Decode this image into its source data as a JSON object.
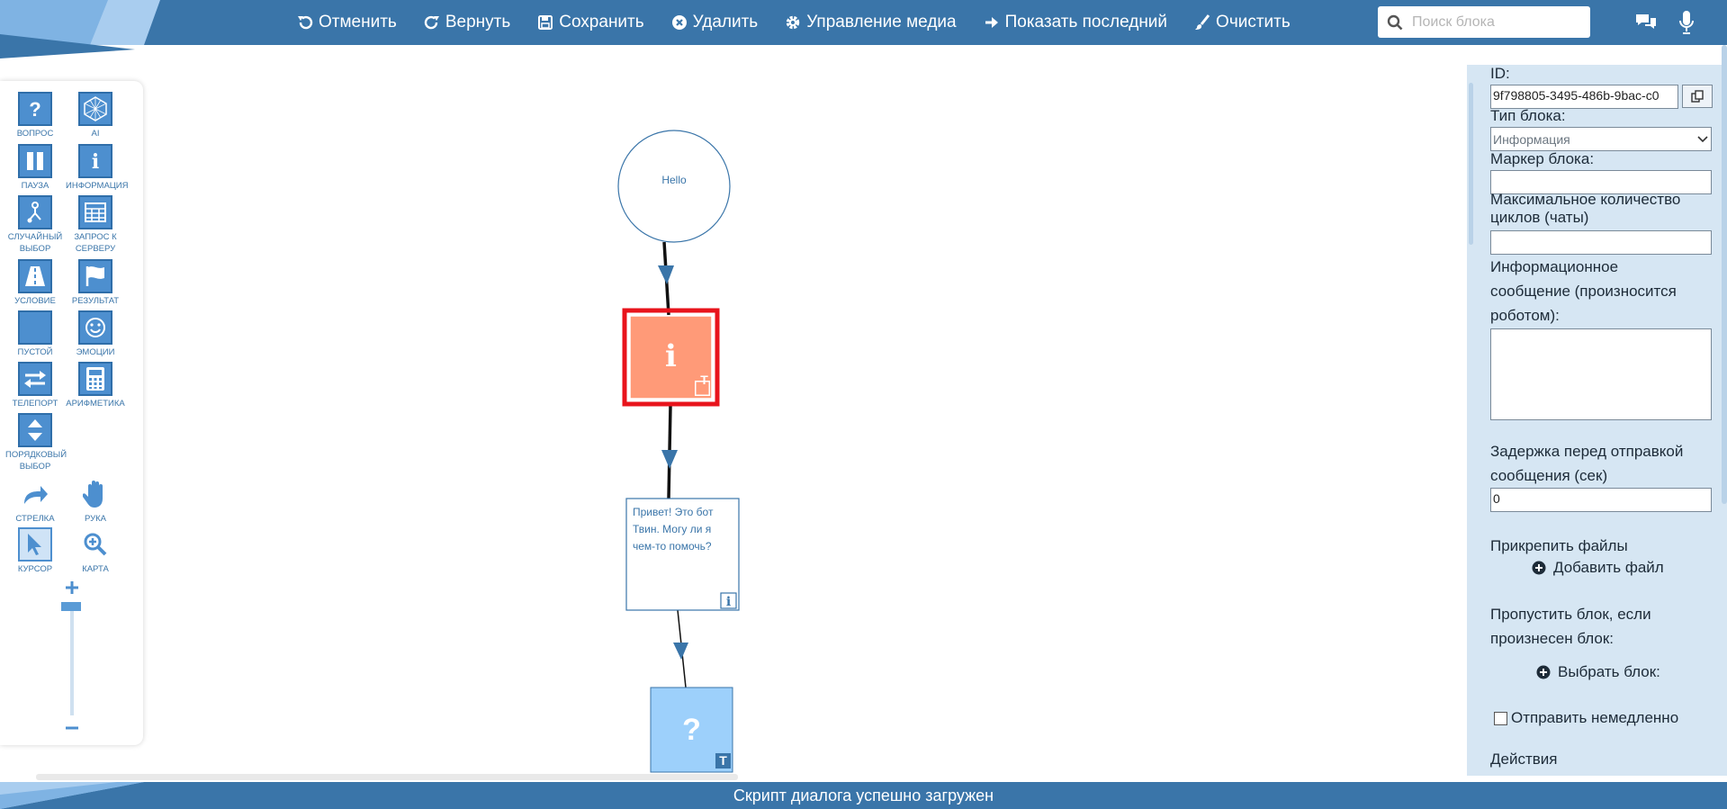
{
  "toolbar": {
    "undo": "Отменить",
    "redo": "Вернуть",
    "save": "Сохранить",
    "delete": "Удалить",
    "media": "Управление медиа",
    "show_last": "Показать последний",
    "clear": "Очистить"
  },
  "search": {
    "placeholder": "Поиск блока"
  },
  "palette": {
    "question": "ВОПРОС",
    "ai": "AI",
    "pause": "ПАУЗА",
    "info": "ИНФОРМАЦИЯ",
    "random_line1": "СЛУЧАЙНЫЙ",
    "random_line2": "ВЫБОР",
    "server_line1": "ЗАПРОС К",
    "server_line2": "СЕРВЕРУ",
    "condition": "УСЛОВИЕ",
    "result": "РЕЗУЛЬТАТ",
    "empty": "ПУСТОЙ",
    "emotions": "ЭМОЦИИ",
    "teleport": "ТЕЛЕПОРТ",
    "arithmetic": "АРИФМЕТИКА",
    "ordinal_line1": "ПОРЯДКОВЫЙ",
    "ordinal_line2": "ВЫБОР",
    "arrow": "СТРЕЛКА",
    "hand": "РУКА",
    "cursor": "КУРСОР",
    "map": "КАРТА"
  },
  "canvas": {
    "start_node_text": "Hello",
    "message_node_line1": "Привет! Это бот",
    "message_node_line2": "Твин. Могу ли я",
    "message_node_line3": "чем-то помочь?",
    "badge_t": "T"
  },
  "panel": {
    "id_label": "ID:",
    "id_value": "9f798805-3495-486b-9bac-c0",
    "block_type_label": "Тип блока:",
    "block_type_value": "Информация",
    "marker_label": "Маркер блока:",
    "marker_value": "",
    "max_cycles_line1": "Максимальное количество",
    "max_cycles_line2": "циклов (чаты)",
    "max_cycles_value": "",
    "info_msg_line1": "Информационное",
    "info_msg_line2": "сообщение (произносится",
    "info_msg_line3": "роботом):",
    "info_msg_value": "",
    "delay_line1": "Задержка перед отправкой",
    "delay_line2": "сообщения (сек)",
    "delay_value": "0",
    "attach_label": "Прикрепить файлы",
    "add_file": "Добавить файл",
    "skip_line1": "Пропустить блок, если",
    "skip_line2": "произнесен блок:",
    "choose_block": "Выбрать блок:",
    "send_now": "Отправить немедленно",
    "actions": "Действия"
  },
  "status": {
    "message": "Скрипт диалога успешно загружен"
  },
  "colors": {
    "primary": "#3a75a9",
    "tile": "#4d8fcf",
    "selected_node_fill": "#ff9a78",
    "selected_node_border": "#e8141c",
    "question_node_fill": "#9dd0fb",
    "panel_bg": "#d6e6f3"
  }
}
